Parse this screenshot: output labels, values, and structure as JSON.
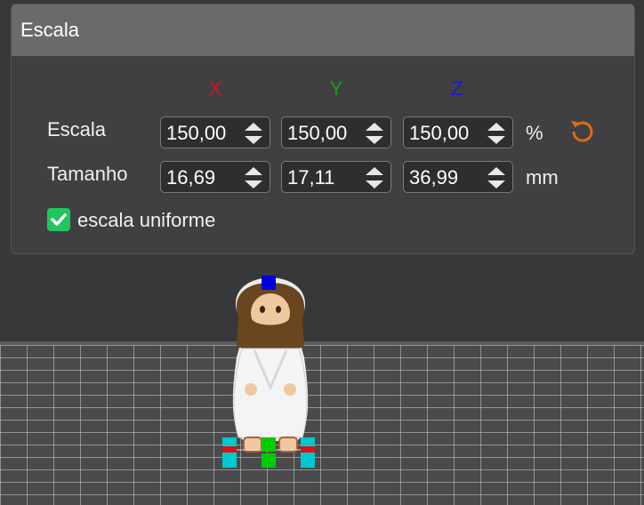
{
  "panel": {
    "title": "Escala",
    "axes": [
      {
        "label": "X",
        "color": "#d01818"
      },
      {
        "label": "Y",
        "color": "#1e9a1e"
      },
      {
        "label": "Z",
        "color": "#1a1ad8"
      }
    ],
    "scale_row": {
      "label": "Escala",
      "values": [
        "150,00",
        "150,00",
        "150,00"
      ],
      "unit": "%"
    },
    "size_row": {
      "label": "Tamanho",
      "values": [
        "16,69",
        "17,11",
        "36,99"
      ],
      "unit": "mm"
    },
    "uniform_scale": {
      "label": "escala uniforme",
      "checked": true
    },
    "reset_icon": "reset-rotate-icon",
    "reset_color": "#e06a1a"
  },
  "viewport": {
    "model": "figurine-model",
    "handle_colors": {
      "z": "#0000dd",
      "x": "#dd1111",
      "y": "#00cc00",
      "corner": "#00c8d0"
    }
  }
}
